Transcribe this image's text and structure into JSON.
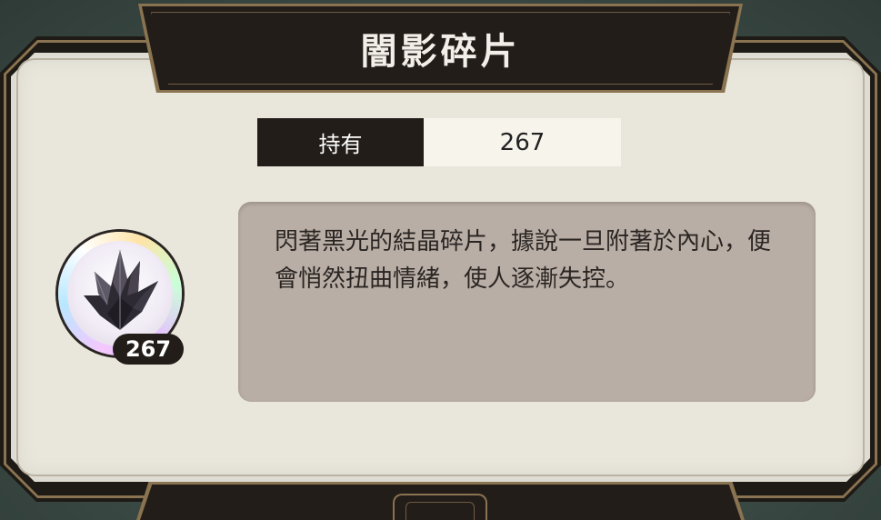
{
  "dialog": {
    "title": "闇影碎片"
  },
  "holding": {
    "label": "持有",
    "value": "267"
  },
  "item": {
    "icon": "dark-crystal-shard-icon",
    "count_badge": "267",
    "description": "閃著黑光的結晶碎片，據說一旦附著於內心，便會悄然扭曲情緒，使人逐漸失控。"
  },
  "colors": {
    "frame_dark": "#221d19",
    "frame_gold": "#8a7350",
    "panel_cream": "#e9e6dc",
    "description_bg": "#b9aea6",
    "background": "#3b4a45"
  }
}
